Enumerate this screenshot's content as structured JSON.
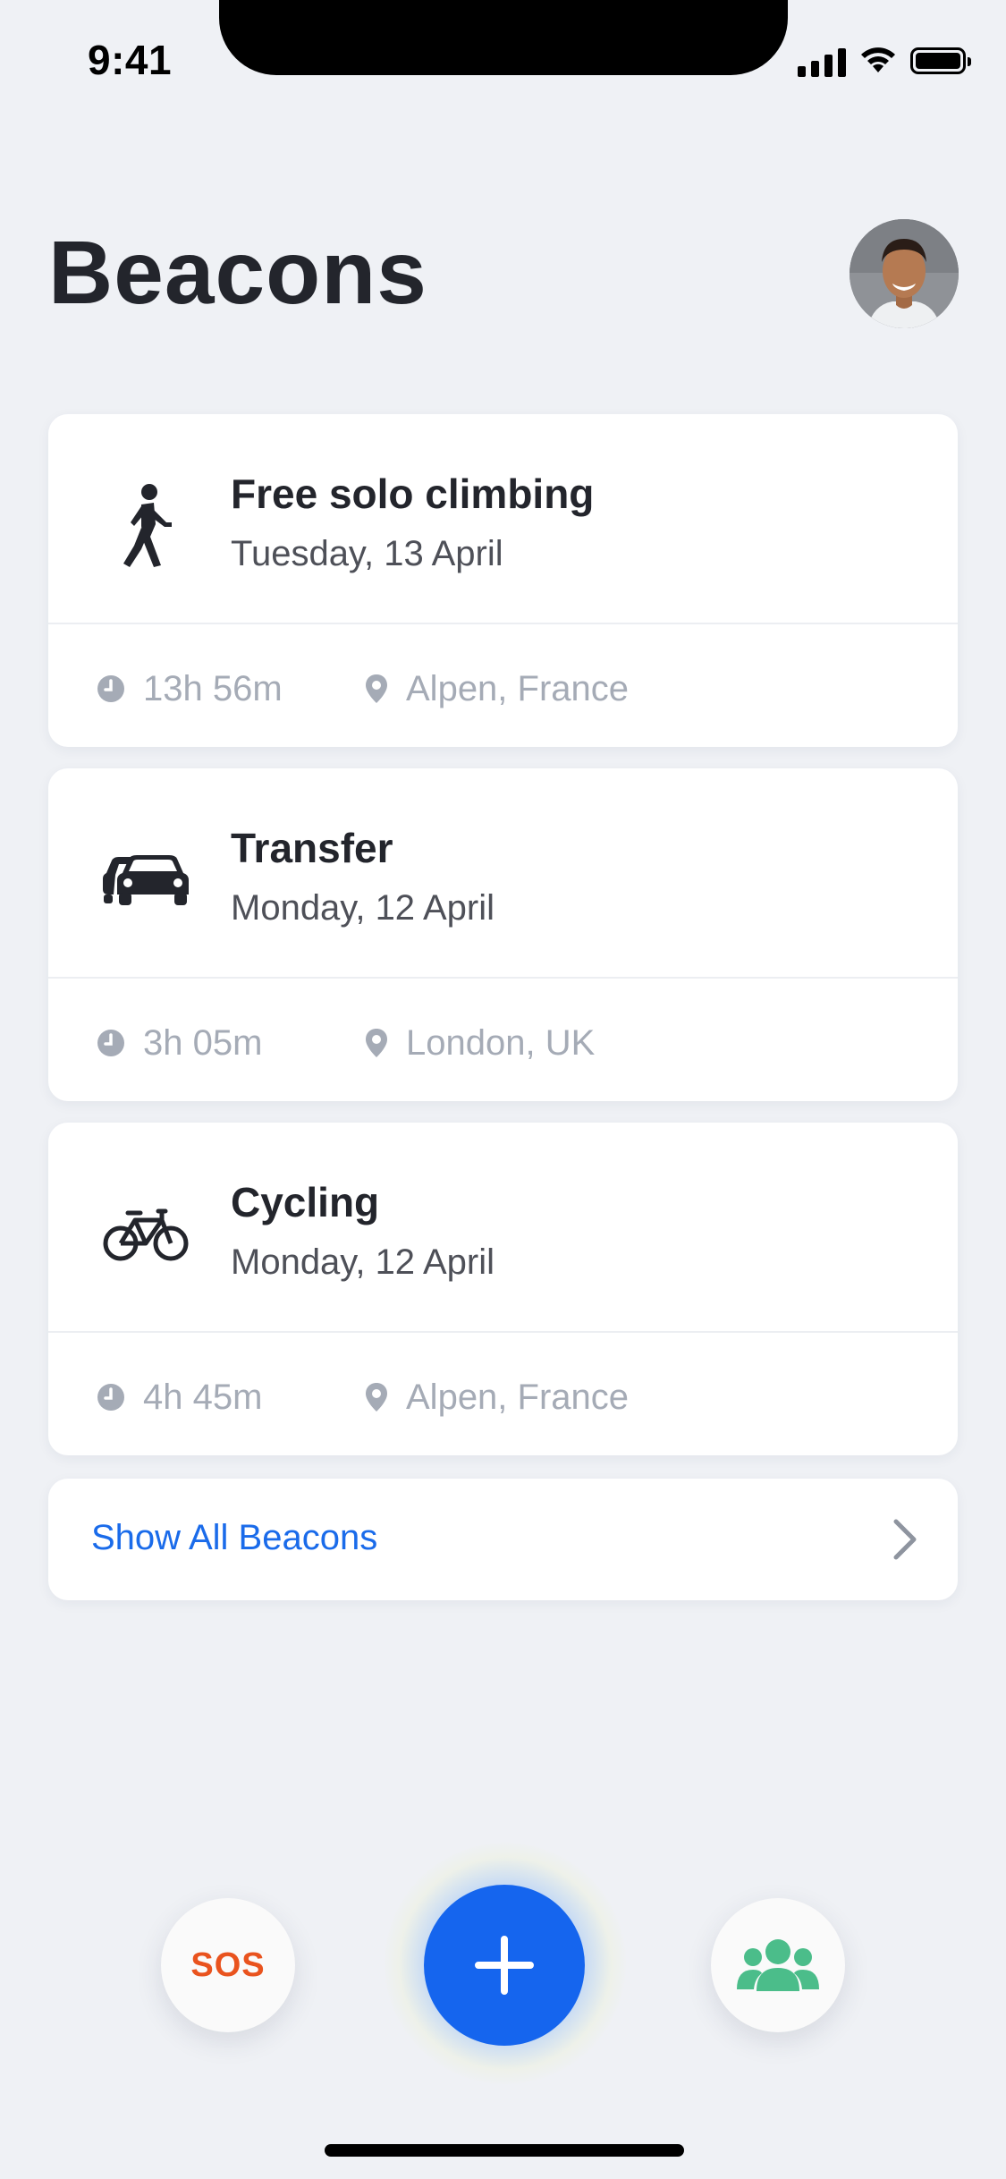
{
  "status_bar": {
    "time": "9:41"
  },
  "header": {
    "title": "Beacons"
  },
  "beacons": [
    {
      "icon": "walking-person-icon",
      "title": "Free solo climbing",
      "date": "Tuesday, 13 April",
      "duration": "13h 56m",
      "location": "Alpen, France"
    },
    {
      "icon": "car-icon",
      "title": "Transfer",
      "date": "Monday, 12 April",
      "duration": "3h 05m",
      "location": "London, UK"
    },
    {
      "icon": "bicycle-icon",
      "title": "Cycling",
      "date": "Monday, 12 April",
      "duration": "4h 45m",
      "location": "Alpen, France"
    }
  ],
  "show_all": {
    "label": "Show All Beacons"
  },
  "actions": {
    "sos_label": "SOS",
    "add_icon": "plus-icon",
    "group_icon": "group-icon"
  },
  "colors": {
    "accent": "#1565ee",
    "link": "#1a6bea",
    "sos": "#e9531e",
    "group": "#4bbd8a",
    "background": "#eff1f5",
    "meta": "#a5abb6"
  }
}
